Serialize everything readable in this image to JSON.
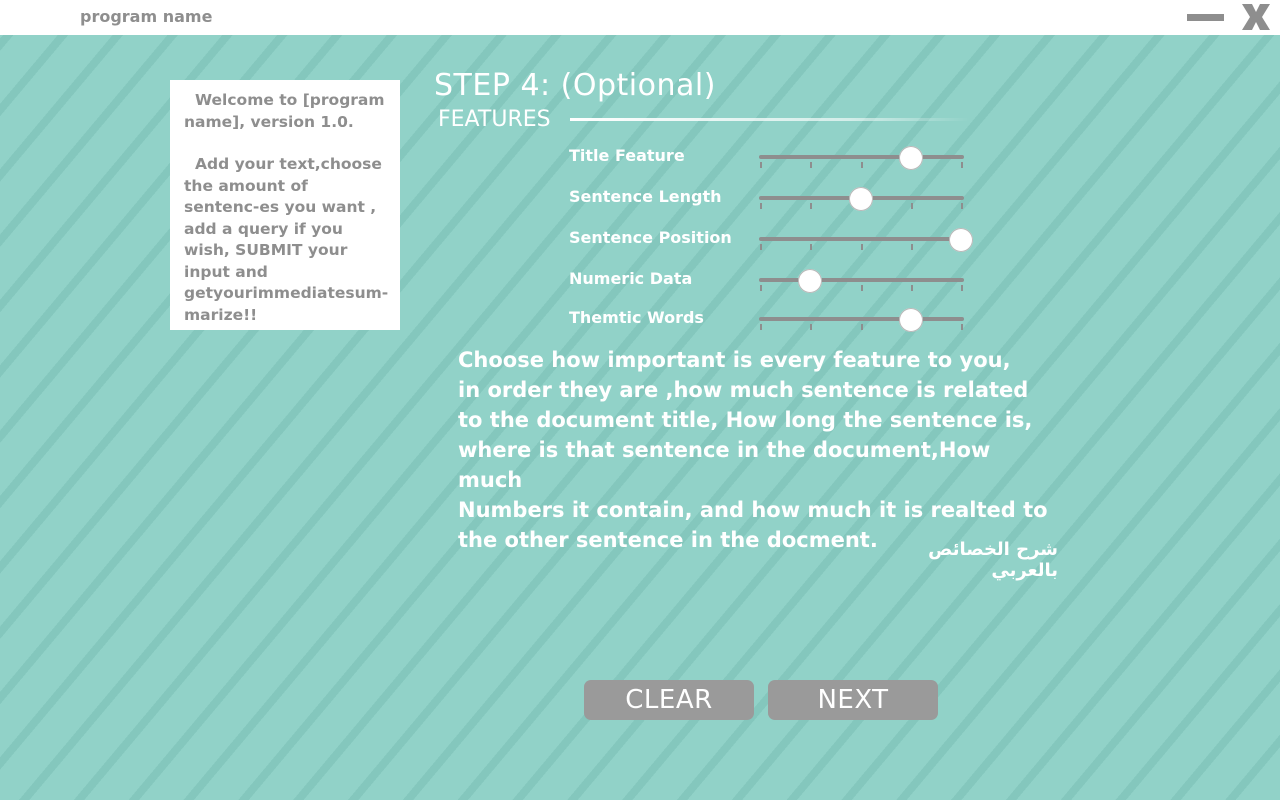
{
  "window": {
    "program_name": "program name",
    "minimize_icon": "minimize-icon",
    "close_icon": "close-icon"
  },
  "welcome": {
    "paragraph1": "Welcome to [program name], version 1.0.",
    "paragraph2": "Add your text,choose the amount of sentenc-es you want , add a query if you wish, SUBMIT your input and getyourimmediatesum-marize!!"
  },
  "step": {
    "title": "STEP 4: (Optional)",
    "section_label": "FEATURES"
  },
  "features": [
    {
      "label": "Title Feature",
      "value": 0.75
    },
    {
      "label": "Sentence Length",
      "value": 0.5
    },
    {
      "label": "Sentence Position",
      "value": 1.0
    },
    {
      "label": "Numeric Data",
      "value": 0.25
    },
    {
      "label": "Themtic Words",
      "value": 0.75
    }
  ],
  "slider_steps": 5,
  "description": "Choose how important is every feature to you,\nin order they are ,how much sentence is related\nto the document title, How long the sentence is,\nwhere is that sentence in the document,How much\nNumbers it contain, and how much it is realted to\nthe other sentence in the docment.",
  "arabic_link": "شرح الخصائص بالعربي",
  "buttons": {
    "clear": "CLEAR",
    "next": "NEXT"
  },
  "colors": {
    "background": "#91d2c8",
    "stripe": "#84c7bd",
    "panel": "#ffffff",
    "gray": "#8e8e8e",
    "button": "#9a9a9a"
  }
}
